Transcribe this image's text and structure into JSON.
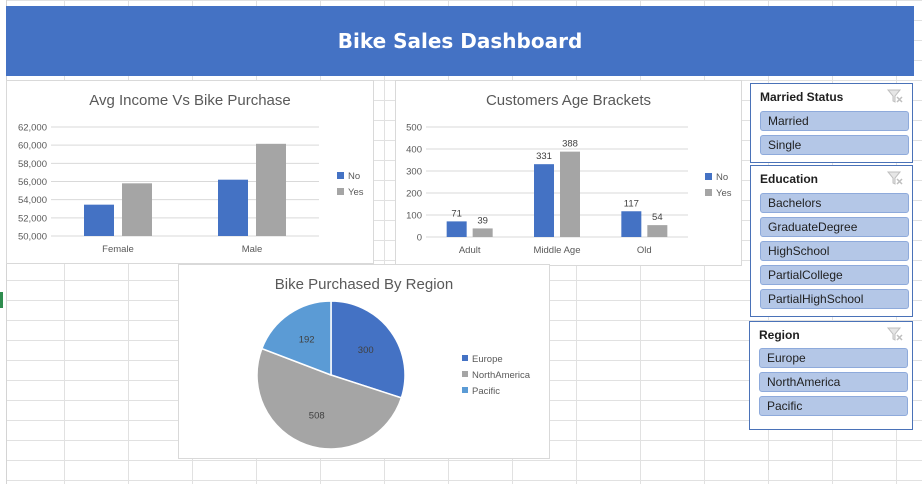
{
  "banner": {
    "title": "Bike Sales Dashboard"
  },
  "colors": {
    "banner": "#4472c4",
    "no": "#4472c4",
    "yes": "#a5a5a5",
    "europe": "#4472c4",
    "north_america": "#a5a5a5",
    "pacific": "#5b9bd5",
    "slicer_item": "#b4c7e7"
  },
  "slicers": {
    "married": {
      "title": "Married Status",
      "items": [
        "Married",
        "Single"
      ]
    },
    "education": {
      "title": "Education",
      "items": [
        "Bachelors",
        "GraduateDegree",
        "HighSchool",
        "PartialCollege",
        "PartialHighSchool"
      ]
    },
    "region": {
      "title": "Region",
      "items": [
        "Europe",
        "NorthAmerica",
        "Pacific"
      ]
    }
  },
  "chart_data": [
    {
      "type": "bar",
      "title": "Avg Income Vs Bike Purchase",
      "categories": [
        "Female",
        "Male"
      ],
      "series": [
        {
          "name": "No",
          "values": [
            53450,
            56200
          ]
        },
        {
          "name": "Yes",
          "values": [
            55800,
            60150
          ]
        }
      ],
      "ylim": [
        50000,
        62000
      ],
      "yticks": [
        "50,000",
        "52,000",
        "54,000",
        "56,000",
        "58,000",
        "60,000",
        "62,000"
      ],
      "legend": "right",
      "grid": true
    },
    {
      "type": "bar",
      "title": "Customers Age Brackets",
      "categories": [
        "Adult",
        "Middle Age",
        "Old"
      ],
      "series": [
        {
          "name": "No",
          "values": [
            71,
            331,
            117
          ]
        },
        {
          "name": "Yes",
          "values": [
            39,
            388,
            54
          ]
        }
      ],
      "ylim": [
        0,
        500
      ],
      "yticks": [
        "0",
        "100",
        "200",
        "300",
        "400",
        "500"
      ],
      "legend": "right",
      "grid": true
    },
    {
      "type": "pie",
      "title": "Bike Purchased By Region",
      "categories": [
        "Europe",
        "NorthAmerica",
        "Pacific"
      ],
      "values": [
        300,
        508,
        192
      ],
      "legend": "right"
    }
  ]
}
